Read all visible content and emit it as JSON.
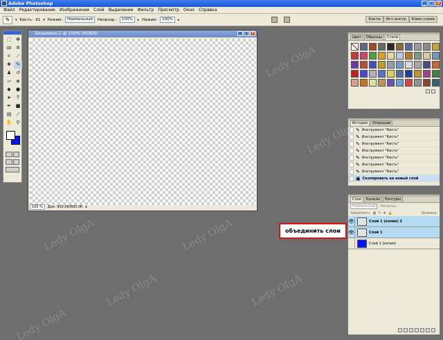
{
  "app": {
    "title": "Adobe Photoshop"
  },
  "menu": [
    "Файл",
    "Редактирование",
    "Изображение",
    "Слой",
    "Выделение",
    "Фильтр",
    "Просмотр",
    "Окно",
    "Справка"
  ],
  "options_bar": {
    "brush_label": "Кисть:",
    "brush_size": "61",
    "mode_label": "Режим:",
    "mode_value": "Нормальный",
    "opacity_label": "Непрозр.:",
    "opacity_value": "100%",
    "flow_label": "Нажим:",
    "flow_value": "100%",
    "palette_well_tabs": [
      "Кисти",
      "Ист.инстр",
      "Комп.слоев"
    ]
  },
  "document": {
    "title": "Безымянн-1 @ 100% (RGB/8)",
    "zoom": "100 %",
    "doc_info": "Док: 900,0К/600,0К"
  },
  "styles_panel": {
    "tabs": [
      "Цвет",
      "Образцы",
      "Стили"
    ],
    "active_tab": "Стили",
    "swatch_colors": [
      "#ffffff",
      "#5a6a8a",
      "#a04a2a",
      "#6a6a6a",
      "#2a2a2a",
      "#8a6a3a",
      "#5a6aa8",
      "#9a9aa0",
      "#8a8a8a",
      "#c8a040",
      "#c83838",
      "#d04870",
      "#50a040",
      "#d8a030",
      "#e8d8a0",
      "#b8c8e0",
      "#b87838",
      "#789888",
      "#d8c8a8",
      "#7898b8",
      "#6a3aa8",
      "#b85030",
      "#4050c0",
      "#c0a020",
      "#90a0b0",
      "#70a0c8",
      "#d8d8e0",
      "#a8a8a8",
      "#484888",
      "#c86830",
      "#c02020",
      "#4848d8",
      "#b0b0c0",
      "#6070c0",
      "#d8d060",
      "#5870a0",
      "#2040a0",
      "#c09030",
      "#a04090",
      "#408040",
      "#d8a090",
      "#c87818",
      "#e0e0a0",
      "#b89858",
      "#7050b0",
      "#68a0d8",
      "#d04848",
      "#909090",
      "#8a4a30",
      "#386070"
    ]
  },
  "history_panel": {
    "tabs": [
      "История",
      "Операции"
    ],
    "active_tab": "История",
    "items": [
      "Инструмент \"Кисть\"",
      "Инструмент \"Кисть\"",
      "Инструмент \"Кисть\"",
      "Инструмент \"Кисть\"",
      "Инструмент \"Кисть\"",
      "Инструмент \"Кисть\"",
      "Инструмент \"Кисть\""
    ],
    "selected_item": "Скопировать на новый слой"
  },
  "layers_panel": {
    "tabs": [
      "Слои",
      "Каналы",
      "Контуры"
    ],
    "active_tab": "Слои",
    "blend_mode": "Нормальный",
    "opacity_label": "Непрозр.:",
    "lock_label": "Закрепить:",
    "fill_label": "Заливка:",
    "layers": [
      {
        "name": "Слой 1 (копия) 2",
        "visible": true,
        "selected": true,
        "thumb": "transparent"
      },
      {
        "name": "Слой 1",
        "visible": true,
        "selected": true,
        "thumb": "transparent"
      },
      {
        "name": "Слой 1 (копия)",
        "visible": false,
        "selected": false,
        "thumb": "blue"
      }
    ]
  },
  "callout": {
    "text": "объединить слои"
  },
  "watermark": "Ledy OlgA",
  "colors": {
    "foreground": "#ffffff",
    "background": "#0014ff",
    "accent": "#d11111"
  }
}
